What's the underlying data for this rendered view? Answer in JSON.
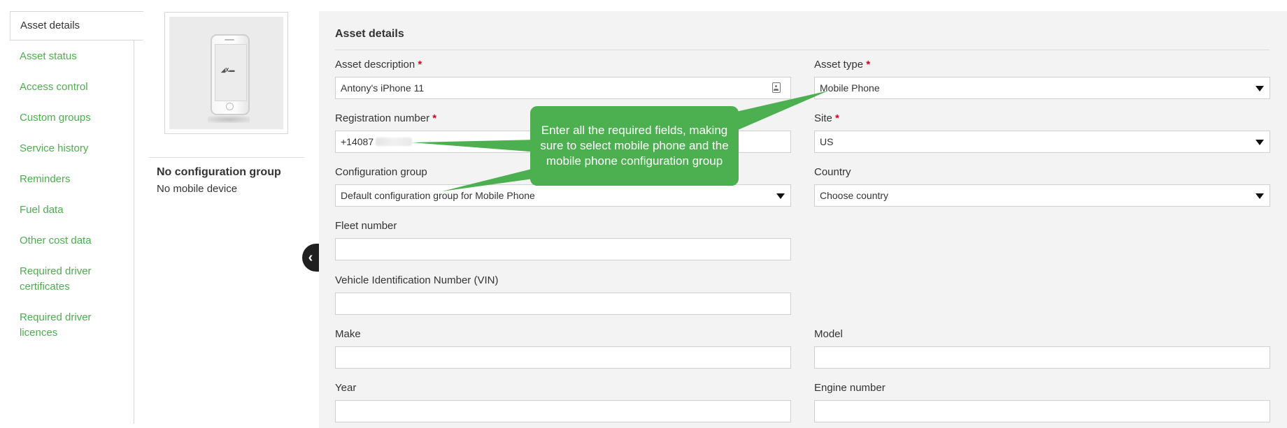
{
  "sidebar": {
    "items": [
      {
        "label": "Asset details",
        "active": true
      },
      {
        "label": "Asset status"
      },
      {
        "label": "Access control"
      },
      {
        "label": "Custom groups"
      },
      {
        "label": "Service history"
      },
      {
        "label": "Reminders"
      },
      {
        "label": "Fuel data"
      },
      {
        "label": "Other cost data"
      },
      {
        "label_line1": "Required driver",
        "label_line2": "certificates"
      },
      {
        "label_line1": "Required driver",
        "label_line2": "licences"
      }
    ]
  },
  "device": {
    "config_title": "No configuration group",
    "config_sub": "No mobile device"
  },
  "form": {
    "section_title": "Asset details",
    "required_mark": "*",
    "asset_description": {
      "label": "Asset description",
      "value": "Antony's iPhone 11"
    },
    "asset_type": {
      "label": "Asset type",
      "value": "Mobile Phone"
    },
    "registration_number": {
      "label": "Registration number",
      "value": "+14087"
    },
    "site": {
      "label": "Site",
      "value": "US"
    },
    "configuration_group": {
      "label": "Configuration group",
      "value": "Default configuration group for Mobile Phone"
    },
    "country": {
      "label": "Country",
      "value": "Choose country"
    },
    "fleet_number": {
      "label": "Fleet number",
      "value": ""
    },
    "vin": {
      "label": "Vehicle Identification Number (VIN)",
      "value": ""
    },
    "make": {
      "label": "Make",
      "value": ""
    },
    "model": {
      "label": "Model",
      "value": ""
    },
    "year": {
      "label": "Year",
      "value": ""
    },
    "engine_number": {
      "label": "Engine number",
      "value": ""
    }
  },
  "callout": {
    "text": "Enter all the required fields, making sure to select mobile phone and the mobile phone configuration group",
    "color": "#4caf50"
  },
  "colors": {
    "link_green": "#4cae4c",
    "required_red": "#e0001b",
    "form_bg": "#f3f3f3"
  }
}
